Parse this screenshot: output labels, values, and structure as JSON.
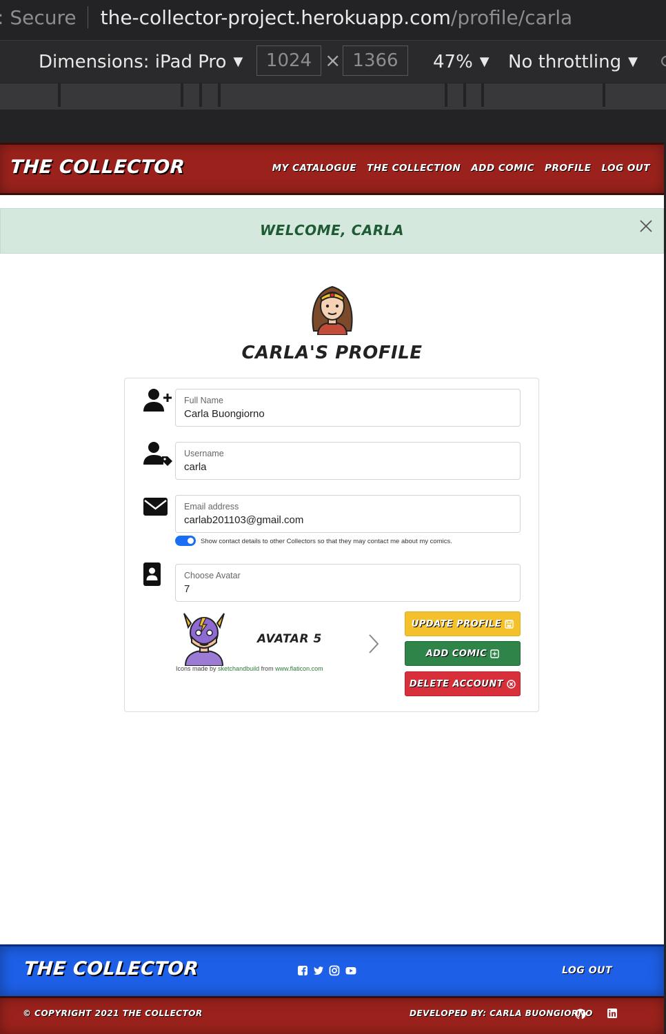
{
  "browser": {
    "secure_label": ": Secure",
    "url_host": "the-collector-project.herokuapp.com",
    "url_path": "/profile/carla"
  },
  "devtools": {
    "dimensions_label": "Dimensions: iPad Pro",
    "width_value": "1024",
    "times_symbol": "×",
    "height_value": "1366",
    "zoom_label": "47%",
    "throttling_label": "No throttling",
    "dropdown_glyph": "▼"
  },
  "nav": {
    "brand": "THE COLLECTOR",
    "links": [
      "MY CATALOGUE",
      "THE COLLECTION",
      "ADD COMIC",
      "PROFILE",
      "LOG OUT"
    ]
  },
  "alert": {
    "message": "WELCOME, CARLA"
  },
  "profile": {
    "title": "CARLA'S PROFILE",
    "fields": {
      "full_name": {
        "label": "Full Name",
        "value": "Carla Buongiorno"
      },
      "username": {
        "label": "Username",
        "value": "carla"
      },
      "email": {
        "label": "Email address",
        "value": "carlab201103@gmail.com"
      },
      "avatar": {
        "label": "Choose Avatar",
        "value": "7"
      }
    },
    "show_contact_label": "Show contact details to other Collectors so that they may contact me about my comics.",
    "show_contact_enabled": true,
    "carousel_caption": "AVATAR 5",
    "credit_prefix": "Icons made by",
    "credit_author": "sketchandbuild",
    "credit_mid": "from",
    "credit_site": "www.flaticon.com"
  },
  "buttons": {
    "update": "UPDATE PROFILE",
    "add": "ADD COMIC",
    "delete": "DELETE ACCOUNT"
  },
  "footer": {
    "brand": "THE COLLECTOR",
    "logout": "LOG OUT",
    "copyright": "© COPYRIGHT 2021 THE COLLECTOR",
    "developer": "DEVELOPED BY: CARLA BUONGIORNO"
  },
  "icons": [
    "facebook-icon",
    "twitter-icon",
    "instagram-icon",
    "youtube-icon",
    "github-icon",
    "linkedin-icon"
  ],
  "colors": {
    "nav_red": "#9b221c",
    "footer_blue": "#1d5fe6",
    "alert_green": "#d4e8de",
    "update_yellow": "#f4c12d",
    "add_green": "#2f8449",
    "delete_red": "#d8303a",
    "toggle_blue": "#1a6ef5"
  }
}
